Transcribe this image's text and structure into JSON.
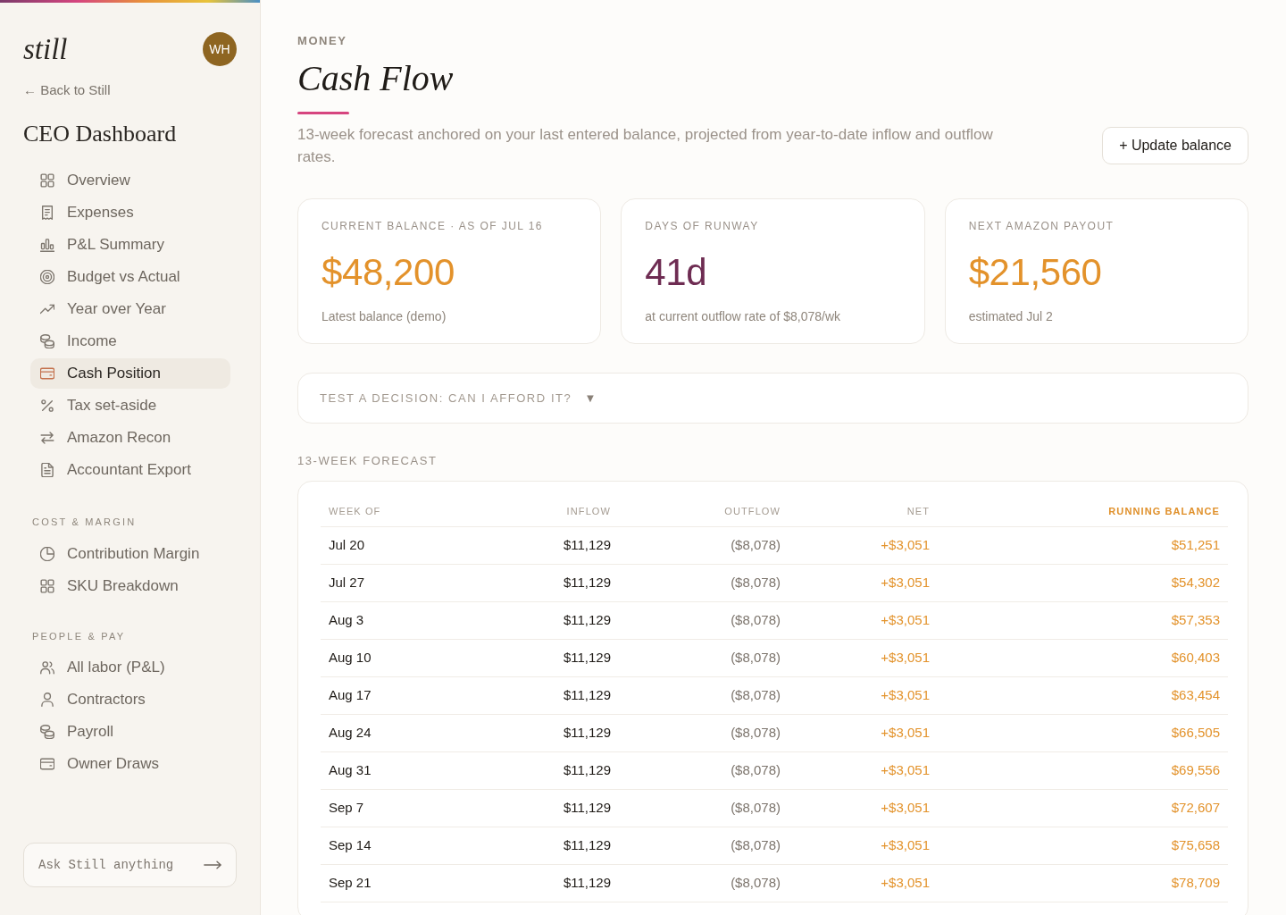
{
  "sidebar": {
    "logo": "still",
    "avatar_initials": "WH",
    "back_link": "← Back to Still",
    "title": "CEO Dashboard",
    "sections": [
      {
        "items": [
          {
            "label": "Overview",
            "selected": false
          },
          {
            "label": "Expenses",
            "selected": false
          },
          {
            "label": "P&L Summary",
            "selected": false
          },
          {
            "label": "Budget vs Actual",
            "selected": false
          },
          {
            "label": "Year over Year",
            "selected": false
          },
          {
            "label": "Income",
            "selected": false
          },
          {
            "label": "Cash Position",
            "selected": true
          },
          {
            "label": "Tax set-aside",
            "selected": false
          },
          {
            "label": "Amazon Recon",
            "selected": false
          },
          {
            "label": "Accountant Export",
            "selected": false
          }
        ]
      },
      {
        "heading": "COST & MARGIN",
        "items": [
          {
            "label": "Contribution Margin",
            "selected": false
          },
          {
            "label": "SKU Breakdown",
            "selected": false
          }
        ]
      },
      {
        "heading": "PEOPLE & PAY",
        "items": [
          {
            "label": "All labor (P&L)",
            "selected": false
          },
          {
            "label": "Contractors",
            "selected": false
          },
          {
            "label": "Payroll",
            "selected": false
          },
          {
            "label": "Owner Draws",
            "selected": false
          }
        ]
      }
    ],
    "ask": {
      "placeholder": "Ask Still anything"
    }
  },
  "header": {
    "eyebrow": "MONEY",
    "title": "Cash Flow",
    "description": "13-week forecast anchored on your last entered balance, projected from year-to-date inflow and outflow rates.",
    "button": "+ Update balance"
  },
  "stats": [
    {
      "label": "CURRENT BALANCE · AS OF JUL 16",
      "value": "$48,200",
      "color": "#e3922b",
      "note": "Latest balance (demo)"
    },
    {
      "label": "DAYS OF RUNWAY",
      "value": "41d",
      "color": "#6e2c52",
      "note": "at current outflow rate of $8,078/wk"
    },
    {
      "label": "NEXT AMAZON PAYOUT",
      "value": "$21,560",
      "color": "#e3922b",
      "note": "estimated Jul 2"
    }
  ],
  "decision": {
    "label": "TEST A DECISION: CAN I AFFORD IT?",
    "caret": "▼"
  },
  "forecast": {
    "title": "13-WEEK FORECAST",
    "columns": [
      {
        "label": "WEEK OF",
        "highlighted": false
      },
      {
        "label": "INFLOW",
        "highlighted": false
      },
      {
        "label": "OUTFLOW",
        "highlighted": false
      },
      {
        "label": "NET",
        "highlighted": false
      },
      {
        "label": "RUNNING BALANCE",
        "highlighted": true
      }
    ],
    "rows": [
      [
        "Jul 20",
        "$11,129",
        "($8,078)",
        "+$3,051",
        "$51,251"
      ],
      [
        "Jul 27",
        "$11,129",
        "($8,078)",
        "+$3,051",
        "$54,302"
      ],
      [
        "Aug 3",
        "$11,129",
        "($8,078)",
        "+$3,051",
        "$57,353"
      ],
      [
        "Aug 10",
        "$11,129",
        "($8,078)",
        "+$3,051",
        "$60,403"
      ],
      [
        "Aug 17",
        "$11,129",
        "($8,078)",
        "+$3,051",
        "$63,454"
      ],
      [
        "Aug 24",
        "$11,129",
        "($8,078)",
        "+$3,051",
        "$66,505"
      ],
      [
        "Aug 31",
        "$11,129",
        "($8,078)",
        "+$3,051",
        "$69,556"
      ],
      [
        "Sep 7",
        "$11,129",
        "($8,078)",
        "+$3,051",
        "$72,607"
      ],
      [
        "Sep 14",
        "$11,129",
        "($8,078)",
        "+$3,051",
        "$75,658"
      ],
      [
        "Sep 21",
        "$11,129",
        "($8,078)",
        "+$3,051",
        "$78,709"
      ]
    ]
  }
}
